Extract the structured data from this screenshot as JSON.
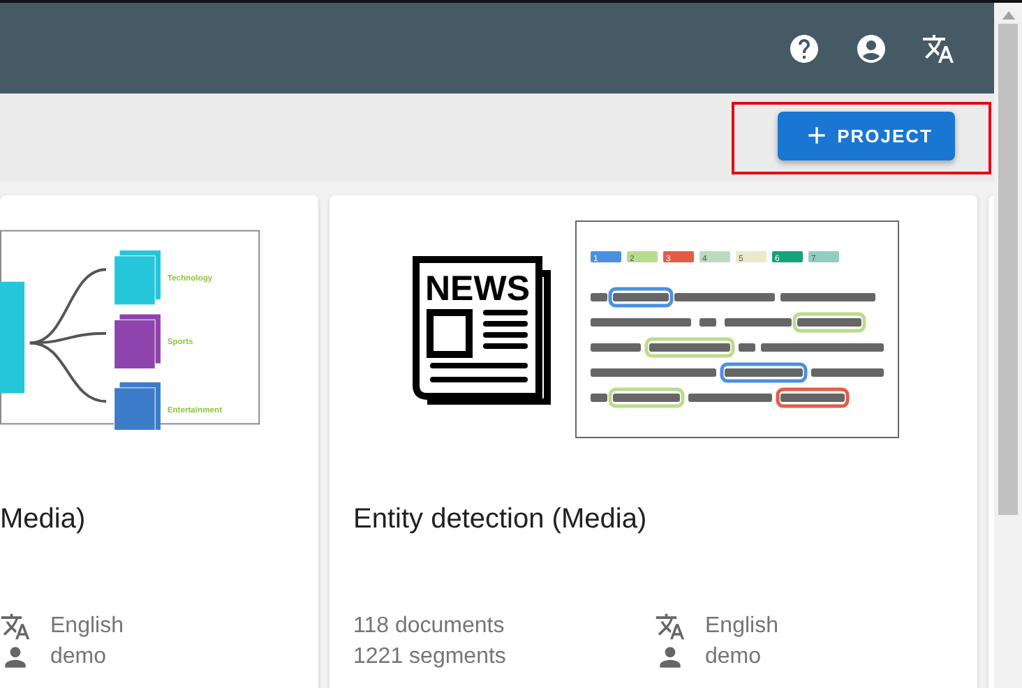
{
  "toolbar": {
    "new_project_button": {
      "label": "PROJECT",
      "highlighted": true
    }
  },
  "projects": [
    {
      "kind": "classification",
      "title": "Media)",
      "illustration_labels": [
        "Technology",
        "Sports",
        "Entertainment"
      ],
      "language": "English",
      "owner": "demo"
    },
    {
      "kind": "entities",
      "title": "Entity detection (Media)",
      "icon_text": "NEWS",
      "illustration_legend": [
        {
          "label": "1",
          "color": "#4a90e2"
        },
        {
          "label": "2",
          "color": "#b9dc8c"
        },
        {
          "label": "3",
          "color": "#e35d46"
        },
        {
          "label": "4",
          "color": "#bcdcc0"
        },
        {
          "label": "5",
          "color": "#eaeacb"
        },
        {
          "label": "6",
          "color": "#16a37b"
        },
        {
          "label": "7",
          "color": "#90cfc0"
        }
      ],
      "stats": [
        "118 documents",
        "1221 segments"
      ],
      "language": "English",
      "owner": "demo"
    },
    {
      "kind": "blank"
    }
  ]
}
